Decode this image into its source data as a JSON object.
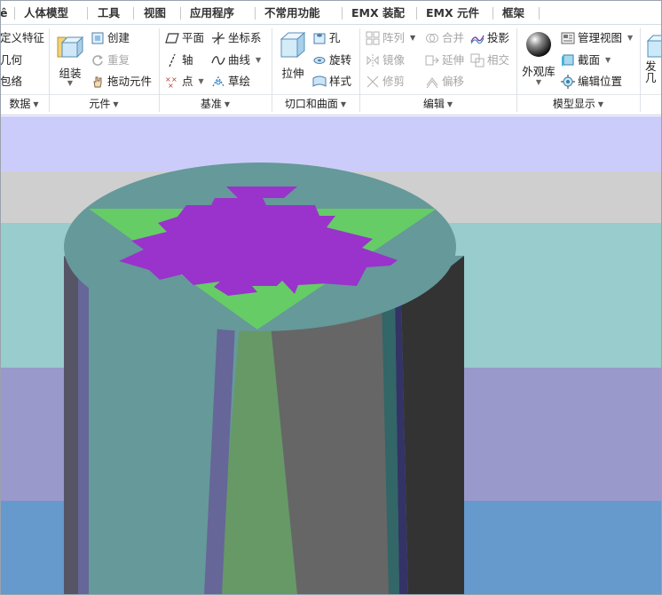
{
  "menu": {
    "tabs": [
      "ê",
      "人体模型",
      "工具",
      "视图",
      "应用程序",
      "不常用功能",
      "EMX 装配",
      "EMX 元件",
      "框架"
    ]
  },
  "ribbon": {
    "data_group": {
      "items": [
        "定义特征",
        "几何",
        "包络"
      ],
      "label": "数据"
    },
    "component_group": {
      "assemble": "组装",
      "create": "创建",
      "repeat": "重复",
      "drag": "拖动元件",
      "label": "元件"
    },
    "datum_group": {
      "plane": "平面",
      "coord": "坐标系",
      "axis": "轴",
      "curve": "曲线",
      "point": "点",
      "sketch": "草绘",
      "label": "基准"
    },
    "cut_group": {
      "extrude": "拉伸",
      "hole": "孔",
      "revolve": "旋转",
      "style": "样式",
      "label": "切口和曲面"
    },
    "edit_group": {
      "pattern": "阵列",
      "mirror": "镜像",
      "trim": "修剪",
      "merge": "合并",
      "extend": "延伸",
      "offset": "偏移",
      "project": "投影",
      "intersect": "相交",
      "label": "编辑"
    },
    "display_group": {
      "appearance": "外观库",
      "manage_view": "管理视图",
      "section": "截面",
      "edit_position": "编辑位置",
      "label": "模型显示"
    },
    "publish": {
      "line1": "发",
      "line2": "几"
    }
  },
  "colors": {
    "sky_band_1": "#ccccfa",
    "sky_band_2": "#cfcfcf",
    "sky_band_3": "#99cccc",
    "sky_band_4": "#9999cc",
    "sky_band_5": "#6699cc",
    "cylinder_top": "#669999",
    "cylinder_front": "#669999",
    "cylinder_shadow": "#333333",
    "cylinder_mid": "#666666",
    "purple_cross": "#9933cc",
    "green_triangle": "#66cc66"
  }
}
